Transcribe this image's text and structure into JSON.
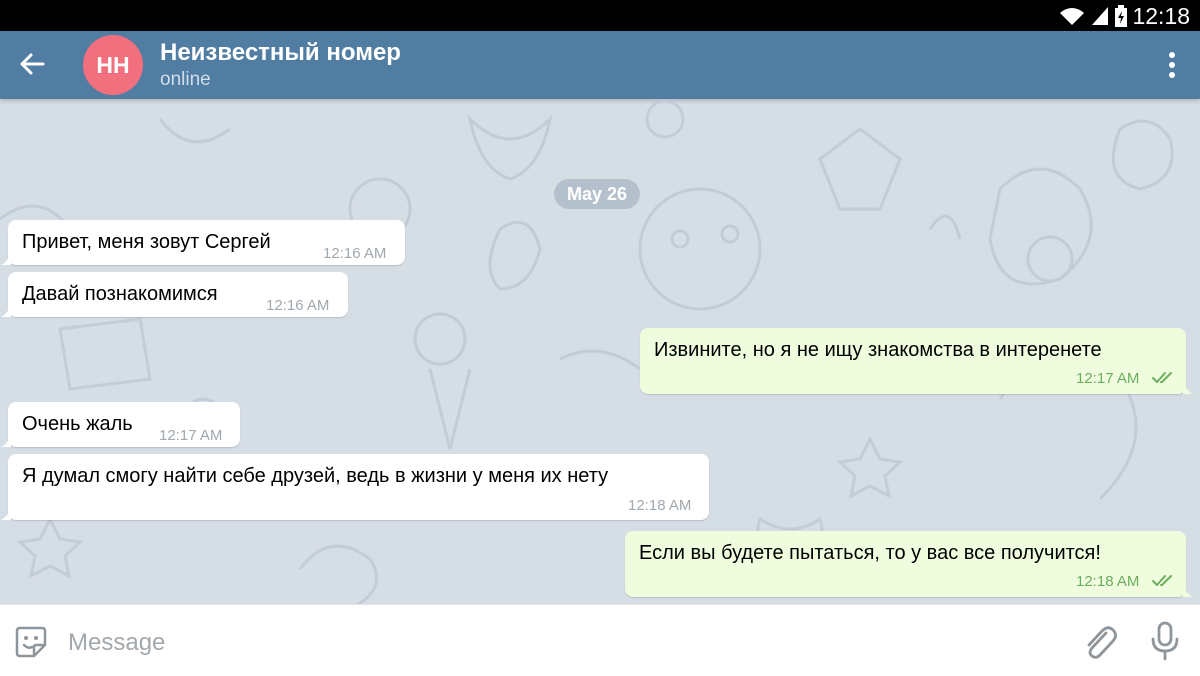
{
  "status_bar": {
    "time": "12:18"
  },
  "header": {
    "back_icon": "arrow-left-icon",
    "avatar_initials": "HH",
    "title": "Неизвестный номер",
    "subtitle": "online",
    "menu_icon": "more-vertical-icon"
  },
  "chat": {
    "date_label": "May 26",
    "messages": [
      {
        "direction": "in",
        "text": "Привет, меня зовут Сергей",
        "time": "12:16 AM"
      },
      {
        "direction": "in",
        "text": "Давай познакомимся",
        "time": "12:16 AM"
      },
      {
        "direction": "out",
        "text": "Извините, но я не ищу знакомства в интеренете",
        "time": "12:17 AM",
        "status": "read"
      },
      {
        "direction": "in",
        "text": "Очень жаль",
        "time": "12:17 AM"
      },
      {
        "direction": "in",
        "text": "Я думал смогу найти себе друзей, ведь в жизни у меня их нету",
        "time": "12:18 AM"
      },
      {
        "direction": "out",
        "text": "Если вы будете пытаться, то у вас все получится!",
        "time": "12:18 AM",
        "status": "read"
      }
    ]
  },
  "input_bar": {
    "placeholder": "Message",
    "emoji_icon": "sticker-icon",
    "attach_icon": "paperclip-icon",
    "mic_icon": "microphone-icon"
  },
  "colors": {
    "header": "#517da2",
    "avatar": "#f26f7e",
    "outgoing_bubble": "#effdde",
    "incoming_bubble": "#ffffff",
    "chat_background": "#d5dde5",
    "read_checks": "#6dad5f"
  }
}
